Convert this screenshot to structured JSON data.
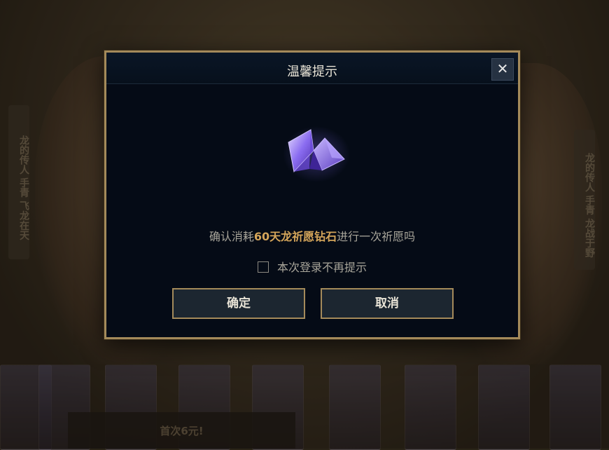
{
  "background": {
    "left_banner_text": "龙的传人 手青 飞龙在天",
    "right_banner_text": "龙的传人 手青 龙战于野",
    "promo_text": "首次6元!"
  },
  "dialog": {
    "title": "温馨提示",
    "close_label": "✕",
    "icon": "crystal-gem-icon",
    "message_prefix": "确认消耗",
    "message_highlight": "60天龙祈愿钻石",
    "message_suffix": "进行一次祈愿吗",
    "checkbox_label": "本次登录不再提示",
    "checkbox_checked": false,
    "confirm_label": "确定",
    "cancel_label": "取消"
  },
  "colors": {
    "accent_gold": "#a48a5a",
    "highlight": "#d4a55a",
    "dialog_bg": "#050b16"
  }
}
